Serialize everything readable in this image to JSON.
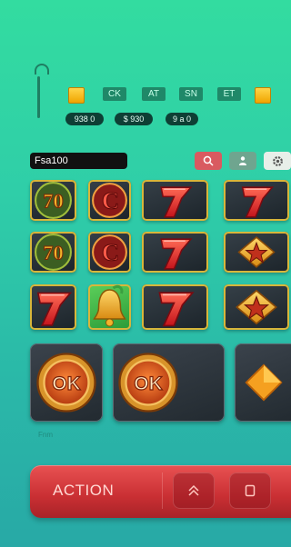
{
  "status": {
    "chips": [
      "CK",
      "AT",
      "SN",
      "ET"
    ],
    "pills": [
      "938 0",
      "$ 930",
      "9 a 0"
    ]
  },
  "filter": {
    "search_value": "Fsa100"
  },
  "footer_caption": "Fnm",
  "action": {
    "label": "ACTION"
  },
  "colors": {
    "background_top": "#33dca0",
    "background_bottom": "#28a9a6",
    "action_red": "#d43a3e",
    "tile_border_gold": "#d8b63a",
    "coin_gold": "#f0a400"
  },
  "reels": {
    "rows": [
      [
        "seventy-emblem-icon",
        "c-emblem-icon",
        "red-seven-icon",
        "red-seven-icon"
      ],
      [
        "seventy-emblem-icon",
        "c-emblem-icon",
        "red-seven-icon",
        "star-diamond-icon"
      ],
      [
        "red-seven-icon",
        "bell-icon",
        "red-seven-icon",
        "star-diamond-icon"
      ]
    ],
    "large_row": [
      "ok-medallion-icon",
      "ok-medallion-icon",
      "orange-diamond-icon"
    ]
  }
}
